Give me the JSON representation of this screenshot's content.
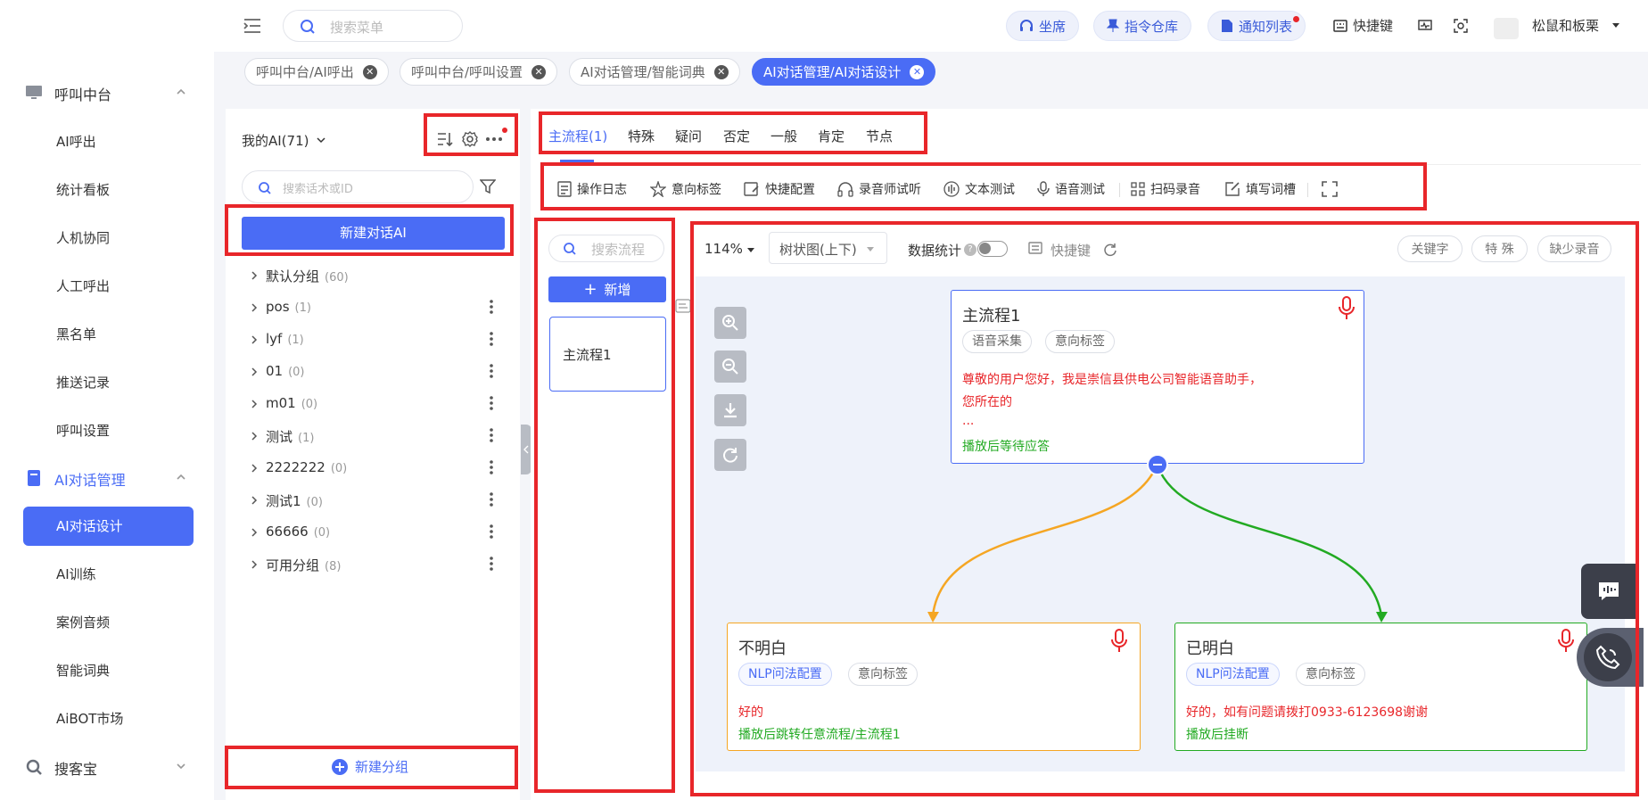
{
  "sidebar": {
    "groups": [
      {
        "label": "呼叫中台"
      },
      {
        "label": "AI对话管理"
      },
      {
        "label": "搜客宝"
      }
    ],
    "call_items": [
      "AI呼出",
      "统计看板",
      "人机协同",
      "人工呼出",
      "黑名单",
      "推送记录",
      "呼叫设置"
    ],
    "ai_items": [
      "AI对话设计",
      "AI训练",
      "案例音频",
      "智能词典",
      "AiBOT市场"
    ]
  },
  "header": {
    "search_placeholder": "搜索菜单",
    "seat": "坐席",
    "command": "指令仓库",
    "notify": "通知列表",
    "hotkey": "快捷键",
    "user": "松鼠和板栗"
  },
  "tabs": [
    "呼叫中台/AI呼出",
    "呼叫中台/呼叫设置",
    "AI对话管理/智能词典",
    "AI对话管理/AI对话设计"
  ],
  "left": {
    "title": "我的AI(71)",
    "search_placeholder": "搜索话术或ID",
    "new_ai": "新建对话AI",
    "new_group": "新建分组",
    "groups": [
      {
        "name": "默认分组",
        "count": "(60)"
      },
      {
        "name": "pos",
        "count": "(1)"
      },
      {
        "name": "lyf",
        "count": "(1)"
      },
      {
        "name": "01",
        "count": "(0)"
      },
      {
        "name": "m01",
        "count": "(0)"
      },
      {
        "name": "测试",
        "count": "(1)"
      },
      {
        "name": "2222222",
        "count": "(0)"
      },
      {
        "name": "测试1",
        "count": "(0)"
      },
      {
        "name": "66666",
        "count": "(0)"
      },
      {
        "name": "可用分组",
        "count": "(8)"
      }
    ]
  },
  "main_tabs": [
    "主流程(1)",
    "特殊",
    "疑问",
    "否定",
    "一般",
    "肯定",
    "节点"
  ],
  "toolbar": [
    "操作日志",
    "意向标签",
    "快捷配置",
    "录音师试听",
    "文本测试",
    "语音测试",
    "扫码录音",
    "填写词槽"
  ],
  "flows": {
    "search_placeholder": "搜索流程",
    "add": "新增",
    "items": [
      "主流程1"
    ]
  },
  "canvas_toolbar": {
    "zoom": "114%",
    "view": "树状图(上下)",
    "stats": "数据统计",
    "hotkey": "快捷键",
    "keyword": "关键字",
    "special": "特 殊",
    "missing": "缺少录音"
  },
  "nodes": {
    "root": {
      "title": "主流程1",
      "chips": [
        "语音采集",
        "意向标签"
      ],
      "text1": "尊敬的用户您好，我是崇信县供电公司智能语音助手，",
      "text2": "您所在的",
      "text3": "...",
      "action": "播放后等待应答"
    },
    "left": {
      "title": "不明白",
      "chips": [
        "NLP问法配置",
        "意向标签"
      ],
      "text": "好的",
      "action": "播放后跳转任意流程/主流程1"
    },
    "right": {
      "title": "已明白",
      "chips": [
        "NLP问法配置",
        "意向标签"
      ],
      "text": "好的，如有问题请拨打0933-6123698谢谢",
      "action": "播放后挂断"
    }
  },
  "colors": {
    "primary": "#4a6cf5",
    "highlight": "#e8262a",
    "orange": "#f5a623",
    "green": "#22aa22"
  }
}
